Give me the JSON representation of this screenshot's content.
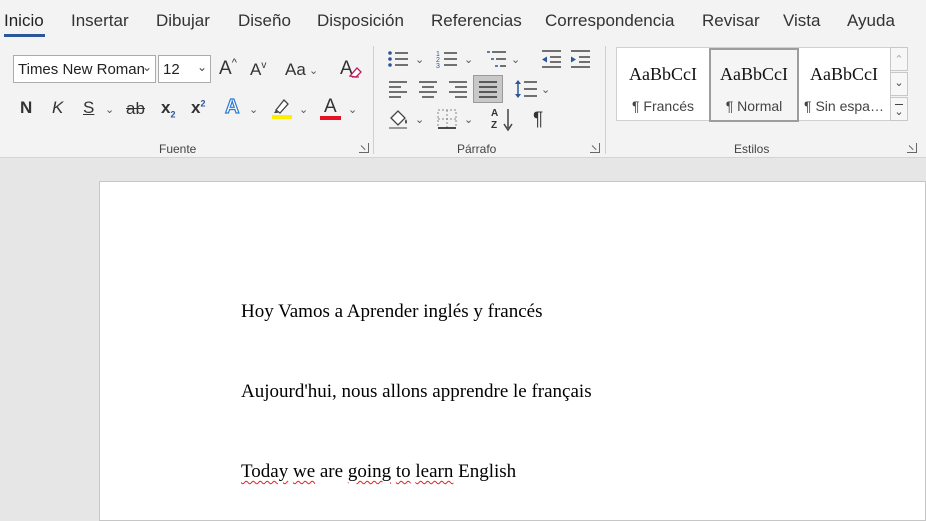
{
  "tabs": [
    {
      "label": "Inicio"
    },
    {
      "label": "Insertar"
    },
    {
      "label": "Dibujar"
    },
    {
      "label": "Diseño"
    },
    {
      "label": "Disposición"
    },
    {
      "label": "Referencias"
    },
    {
      "label": "Correspondencia"
    },
    {
      "label": "Revisar"
    },
    {
      "label": "Vista"
    },
    {
      "label": "Ayuda"
    }
  ],
  "font_group": {
    "label": "Fuente",
    "font_name": "Times New Roman",
    "font_size": "12",
    "grow_font": "A",
    "shrink_font": "A",
    "change_case": "Aa",
    "bold": "N",
    "italic": "K",
    "underline": "S",
    "strikethrough": "ab",
    "subscript": "x",
    "superscript": "x",
    "text_effects": "A",
    "font_color": "A",
    "highlight_color": "#ffee00",
    "font_color_value": "#e81123"
  },
  "paragraph_group": {
    "label": "Párrafo",
    "show_marks": "¶"
  },
  "styles_group": {
    "label": "Estilos",
    "styles": [
      {
        "sample": "AaBbCcI",
        "name": "¶ Francés",
        "selected": false
      },
      {
        "sample": "AaBbCcI",
        "name": "¶ Normal",
        "selected": true
      },
      {
        "sample": "AaBbCcI",
        "name": "¶ Sin espa…",
        "selected": false
      }
    ]
  },
  "document": {
    "paragraphs": [
      {
        "text": "Hoy Vamos a Aprender inglés y francés"
      },
      {
        "text": "Aujourd'hui, nous allons apprendre le français"
      },
      {
        "text_parts": [
          "Today",
          " ",
          "we",
          " are ",
          "going",
          " ",
          "to",
          " ",
          "learn",
          " English"
        ]
      }
    ]
  },
  "colors": {
    "accent": "#2b579a",
    "spellcheck": "#e02020"
  }
}
